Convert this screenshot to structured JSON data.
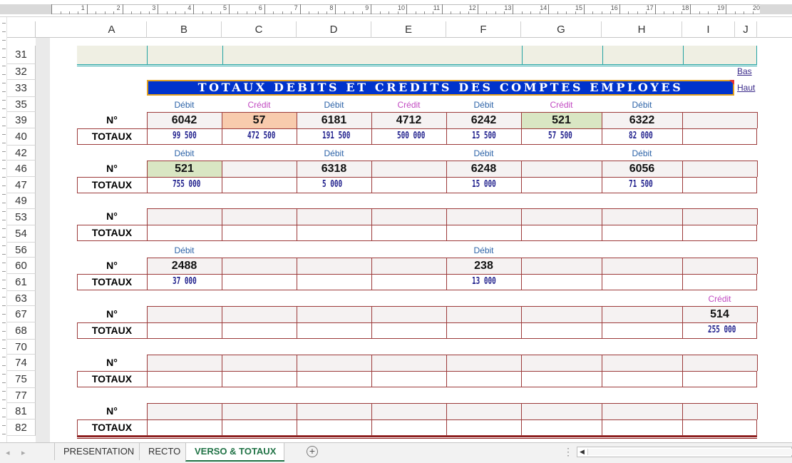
{
  "ruler": {
    "numbers": [
      "1",
      "2",
      "3",
      "4",
      "5",
      "6",
      "7",
      "8",
      "9",
      "10",
      "11",
      "12",
      "13",
      "14",
      "15",
      "16",
      "17",
      "18",
      "19",
      "20"
    ]
  },
  "columns": [
    "A",
    "B",
    "C",
    "D",
    "E",
    "F",
    "G",
    "H",
    "I",
    "J"
  ],
  "rows": [
    "31",
    "32",
    "33",
    "35",
    "39",
    "40",
    "42",
    "46",
    "47",
    "49",
    "53",
    "54",
    "56",
    "60",
    "61",
    "63",
    "67",
    "68",
    "70",
    "74",
    "75",
    "77",
    "81",
    "82"
  ],
  "banner": {
    "title": "TOTAUX DEBITS ET CREDITS DES COMPTES EMPLOYES"
  },
  "links": {
    "bas": "Bas",
    "haut": "Haut"
  },
  "labels": {
    "n": "N°",
    "totaux": "TOTAUX"
  },
  "kinds": {
    "debit": "Débit",
    "credit": "Crédit"
  },
  "blocks": [
    {
      "kinds": [
        "Débit",
        "Crédit",
        "Débit",
        "Crédit",
        "Débit",
        "Crédit",
        "Débit",
        ""
      ],
      "numbers": [
        "6042",
        "57",
        "6181",
        "4712",
        "6242",
        "521",
        "6322",
        ""
      ],
      "totals": [
        "99 500",
        "472 500",
        "191 500",
        "500 000",
        "15 500",
        "57 500",
        "82 000",
        ""
      ]
    },
    {
      "kinds": [
        "Débit",
        "",
        "Débit",
        "",
        "Débit",
        "",
        "Débit",
        ""
      ],
      "numbers": [
        "521",
        "",
        "6318",
        "",
        "6248",
        "",
        "6056",
        ""
      ],
      "totals": [
        "755 000",
        "",
        "5 000",
        "",
        "15 000",
        "",
        "71 500",
        ""
      ]
    },
    {
      "kinds": [
        "",
        "",
        "",
        "",
        "",
        "",
        "",
        ""
      ],
      "numbers": [
        "",
        "",
        "",
        "",
        "",
        "",
        "",
        ""
      ],
      "totals": [
        "",
        "",
        "",
        "",
        "",
        "",
        "",
        ""
      ]
    },
    {
      "kinds": [
        "Débit",
        "",
        "",
        "",
        "Débit",
        "",
        "",
        ""
      ],
      "numbers": [
        "2488",
        "",
        "",
        "",
        "238",
        "",
        "",
        ""
      ],
      "totals": [
        "37 000",
        "",
        "",
        "",
        "13 000",
        "",
        "",
        ""
      ]
    },
    {
      "kinds": [
        "",
        "",
        "",
        "",
        "",
        "",
        "",
        "Crédit"
      ],
      "numbers": [
        "",
        "",
        "",
        "",
        "",
        "",
        "",
        "514"
      ],
      "totals": [
        "",
        "",
        "",
        "",
        "",
        "",
        "",
        "255 000"
      ]
    },
    {
      "kinds": [
        "",
        "",
        "",
        "",
        "",
        "",
        "",
        ""
      ],
      "numbers": [
        "",
        "",
        "",
        "",
        "",
        "",
        "",
        ""
      ],
      "totals": [
        "",
        "",
        "",
        "",
        "",
        "",
        "",
        ""
      ]
    },
    {
      "kinds": [
        "",
        "",
        "",
        "",
        "",
        "",
        "",
        ""
      ],
      "numbers": [
        "",
        "",
        "",
        "",
        "",
        "",
        "",
        ""
      ],
      "totals": [
        "",
        "",
        "",
        "",
        "",
        "",
        "",
        ""
      ]
    }
  ],
  "highlights": {
    "peach": "#f8cbad",
    "green": "#d9e6c3",
    "accent": "#217346",
    "banner": "#0033cc"
  },
  "tabs": [
    "PRESENTATION",
    "RECTO",
    "VERSO & TOTAUX"
  ],
  "active_tab": "VERSO & TOTAUX"
}
